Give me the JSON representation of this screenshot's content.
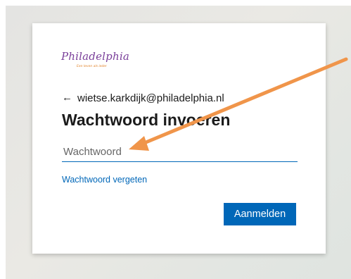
{
  "logo": {
    "wordmark": "Philadelphia",
    "tagline": "Een leven als ieder",
    "brand_color": "#7a3f9a",
    "tagline_color": "#e2842c"
  },
  "identity": {
    "back_icon": "arrow-left-icon",
    "back_glyph": "←",
    "email": "wietse.karkdijk@philadelphia.nl"
  },
  "title": "Wachtwoord invoeren",
  "password_field": {
    "placeholder": "Wachtwoord",
    "value": ""
  },
  "forgot_link": "Wachtwoord vergeten",
  "signin_button": {
    "label": "Aanmelden",
    "color": "#0067b8"
  },
  "annotation": {
    "type": "arrow",
    "color": "#f0954a"
  }
}
